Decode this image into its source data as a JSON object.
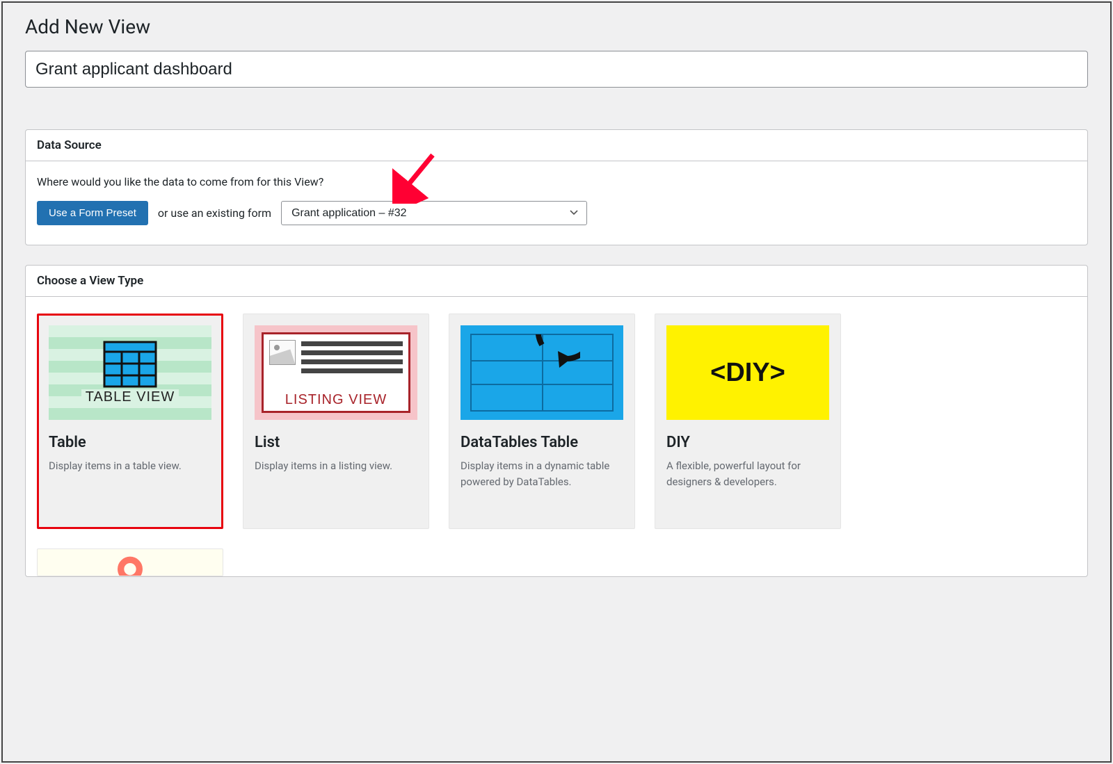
{
  "page": {
    "title": "Add New View",
    "title_input_value": "Grant applicant dashboard"
  },
  "data_source": {
    "panel_title": "Data Source",
    "prompt": "Where would you like the data to come from for this View?",
    "preset_button": "Use a Form Preset",
    "or_text": "or use an existing form",
    "selected_form": "Grant application – #32"
  },
  "view_type": {
    "panel_title": "Choose a View Type",
    "cards": [
      {
        "title": "Table",
        "desc": "Display items in a table view.",
        "thumb_caption": "TABLE VIEW",
        "selected": true
      },
      {
        "title": "List",
        "desc": "Display items in a listing view.",
        "thumb_caption": "LISTING VIEW",
        "selected": false
      },
      {
        "title": "DataTables Table",
        "desc": "Display items in a dynamic table powered by DataTables.",
        "thumb_caption": "",
        "selected": false
      },
      {
        "title": "DIY",
        "desc": "A flexible, powerful layout for designers & developers.",
        "thumb_caption": "<DIY>",
        "selected": false
      }
    ]
  }
}
